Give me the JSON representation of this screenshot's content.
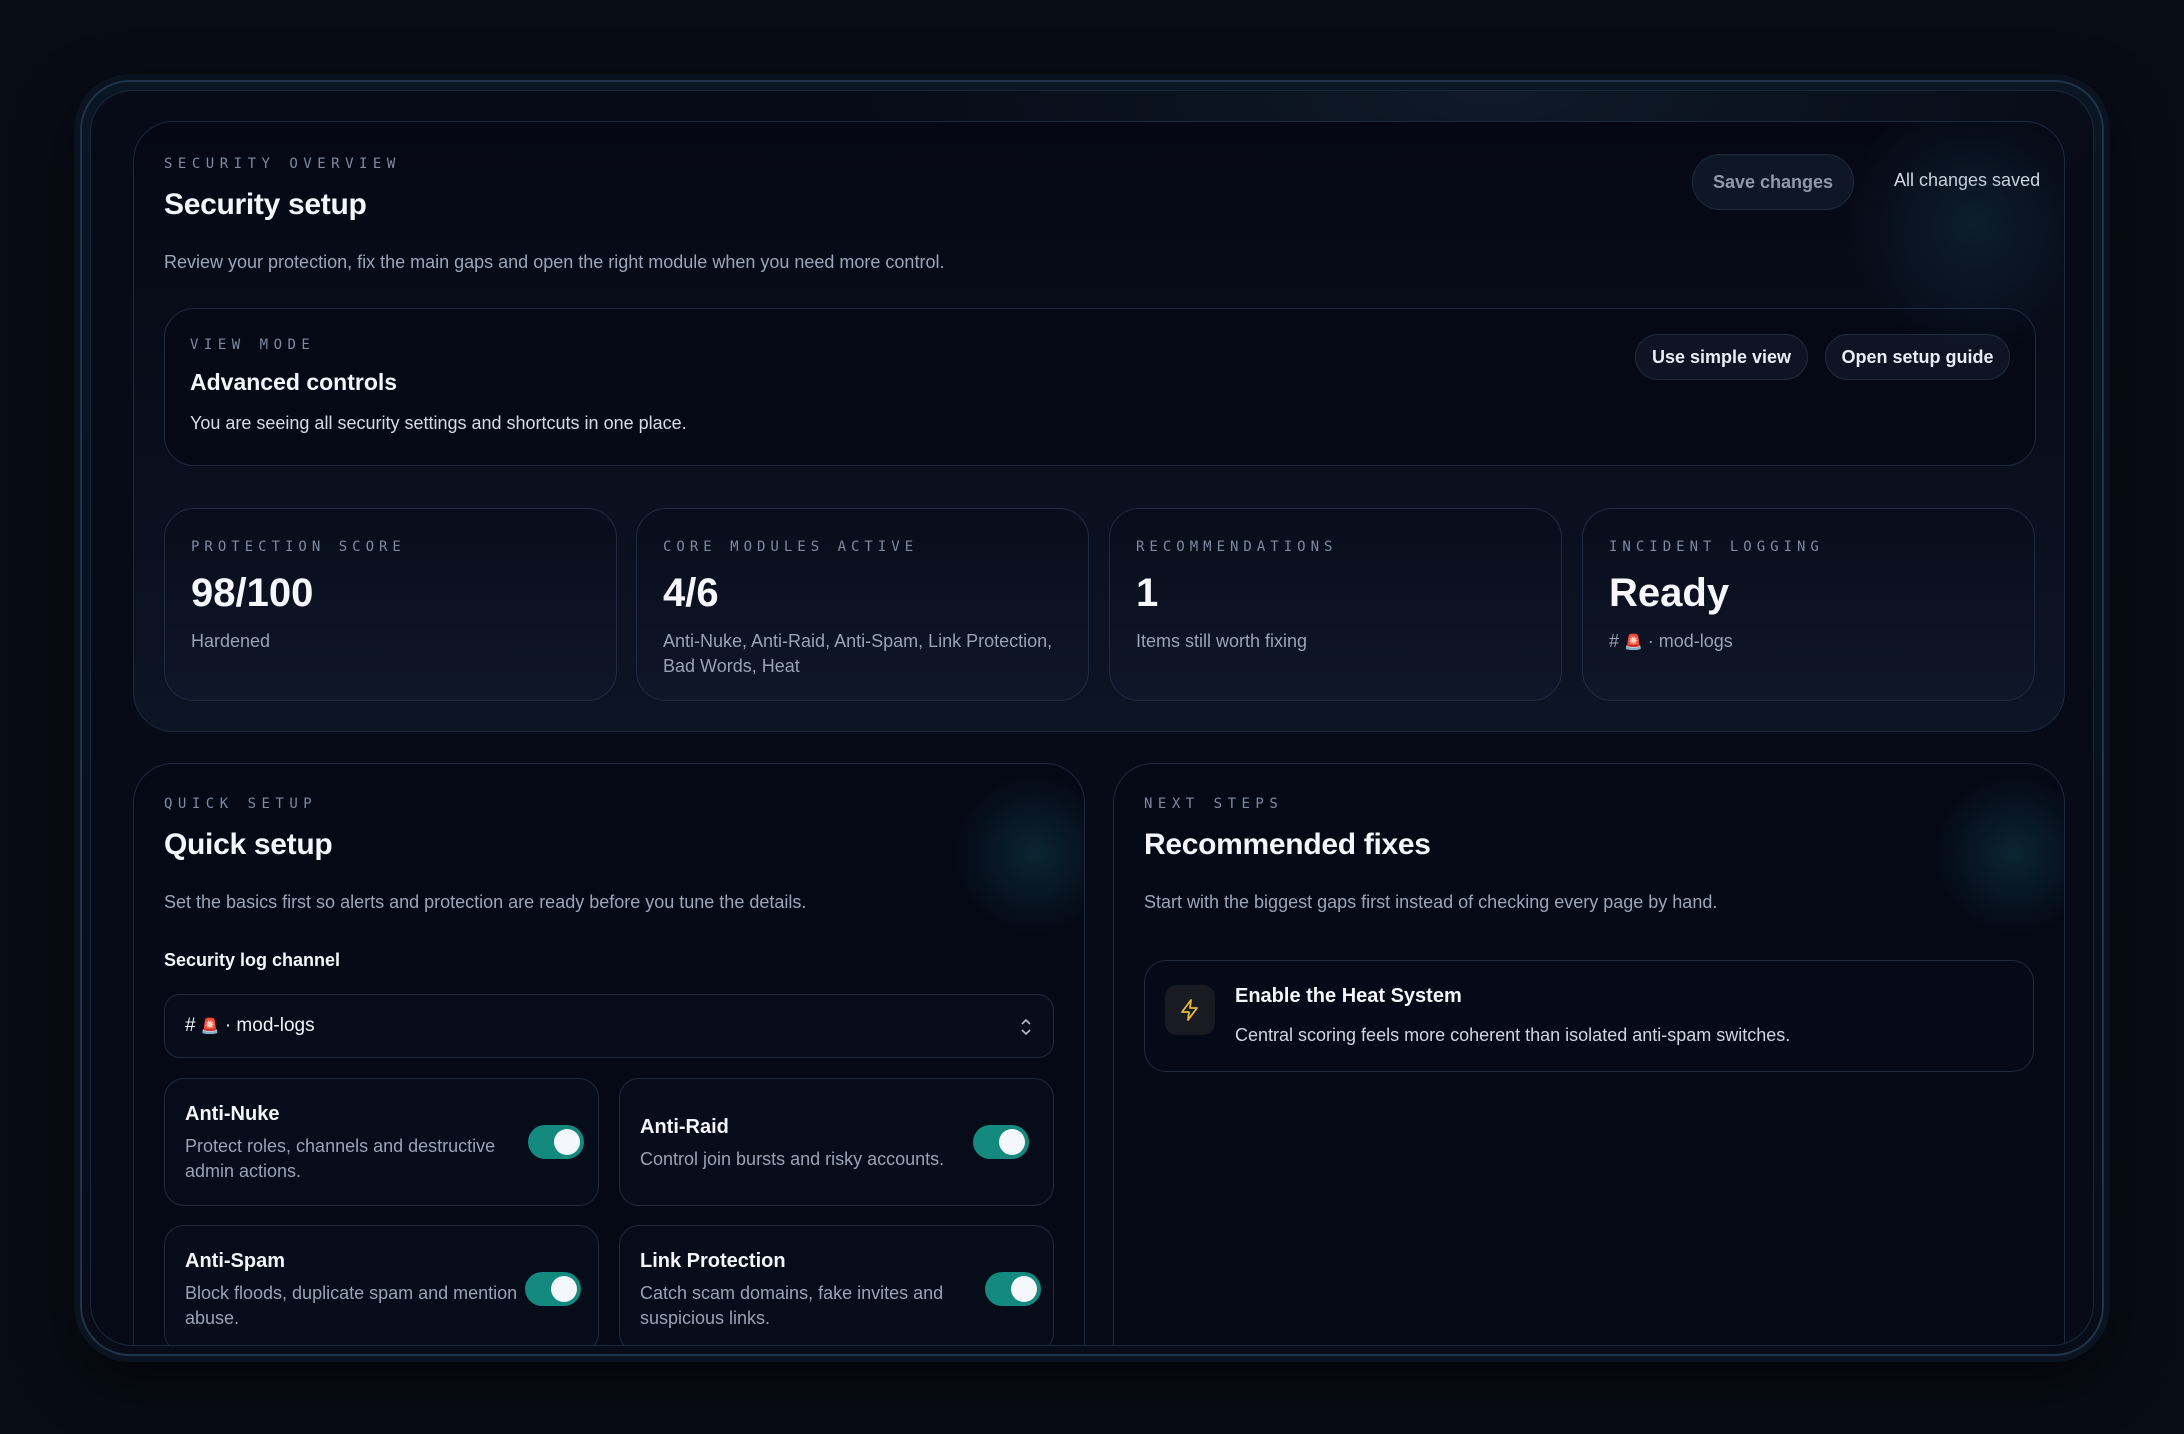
{
  "overview": {
    "eyebrow": "SECURITY OVERVIEW",
    "title": "Security setup",
    "subtitle": "Review your protection, fix the main gaps and open the right module when you need more control.",
    "save_label": "Save changes",
    "save_status": "All changes saved"
  },
  "view_mode": {
    "eyebrow": "VIEW MODE",
    "title": "Advanced controls",
    "description": "You are seeing all security settings and shortcuts in one place.",
    "simple_view_label": "Use simple view",
    "setup_guide_label": "Open setup guide"
  },
  "stats": [
    {
      "label": "PROTECTION SCORE",
      "value": "98/100",
      "description": "Hardened"
    },
    {
      "label": "CORE MODULES ACTIVE",
      "value": "4/6",
      "description": "Anti-Nuke, Anti-Raid, Anti-Spam, Link Protection, Bad Words, Heat"
    },
    {
      "label": "RECOMMENDATIONS",
      "value": "1",
      "description": "Items still worth fixing"
    },
    {
      "label": "INCIDENT LOGGING",
      "value": "Ready",
      "channel_prefix": "#",
      "channel_emoji": "🚨",
      "channel_name": "· mod-logs"
    }
  ],
  "quick_setup": {
    "eyebrow": "QUICK SETUP",
    "title": "Quick setup",
    "subtitle": "Set the basics first so alerts and protection are ready before you tune the details.",
    "log_channel_label": "Security log channel",
    "log_channel_prefix": "#",
    "log_channel_emoji": "🚨",
    "log_channel_name": "· mod-logs",
    "modules": [
      {
        "name": "Anti-Nuke",
        "description": "Protect roles, channels and destructive admin actions.",
        "enabled": true
      },
      {
        "name": "Anti-Raid",
        "description": "Control join bursts and risky accounts.",
        "enabled": true
      },
      {
        "name": "Anti-Spam",
        "description": "Block floods, duplicate spam and mention abuse.",
        "enabled": true
      },
      {
        "name": "Link Protection",
        "description": "Catch scam domains, fake invites and suspicious links.",
        "enabled": true
      }
    ]
  },
  "next_steps": {
    "eyebrow": "NEXT STEPS",
    "title": "Recommended fixes",
    "subtitle": "Start with the biggest gaps first instead of checking every page by hand.",
    "fixes": [
      {
        "title": "Enable the Heat System",
        "description": "Central scoring feels more coherent than isolated anti-spam switches.",
        "icon": "lightning-icon"
      }
    ]
  },
  "colors": {
    "accent_toggle": "#138a7d",
    "background": "#080c15",
    "warning_icon": "#e2b93b"
  }
}
